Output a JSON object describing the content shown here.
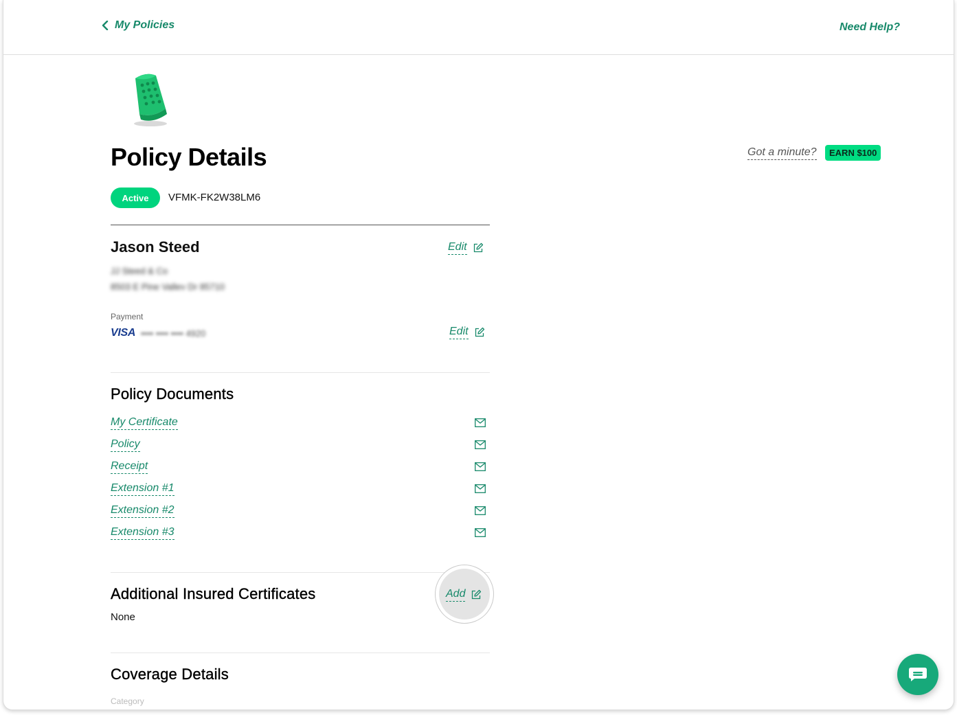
{
  "header": {
    "back_label": "My Policies",
    "help_label": "Need Help?"
  },
  "page": {
    "title": "Policy Details",
    "status": "Active",
    "policy_number": "VFMK-FK2W38LM6"
  },
  "promo": {
    "prompt": "Got a minute?",
    "badge": "EARN $100"
  },
  "insured": {
    "name": "Jason Steed",
    "company": "JJ Steed & Co",
    "address": "8503 E Pine Valley Dr 85710",
    "edit_label": "Edit"
  },
  "payment": {
    "label": "Payment",
    "card_brand": "VISA",
    "card_masked": "•••• •••• •••• 4920",
    "edit_label": "Edit"
  },
  "documents": {
    "title": "Policy Documents",
    "items": [
      {
        "label": "My Certificate",
        "icon": "mail-icon"
      },
      {
        "label": "Policy",
        "icon": "mail-icon"
      },
      {
        "label": "Receipt",
        "icon": "mail-icon"
      },
      {
        "label": "Extension #1",
        "icon": "mail-icon"
      },
      {
        "label": "Extension #2",
        "icon": "mail-icon"
      },
      {
        "label": "Extension #3",
        "icon": "mail-icon"
      }
    ]
  },
  "additional_insured": {
    "title": "Additional Insured Certificates",
    "value": "None",
    "add_label": "Add"
  },
  "coverage": {
    "title": "Coverage Details",
    "category_label": "Category"
  },
  "colors": {
    "accent": "#17896a",
    "status_green": "#00d47e",
    "earn_badge": "#00dc82",
    "chat_button": "#17a97a"
  }
}
